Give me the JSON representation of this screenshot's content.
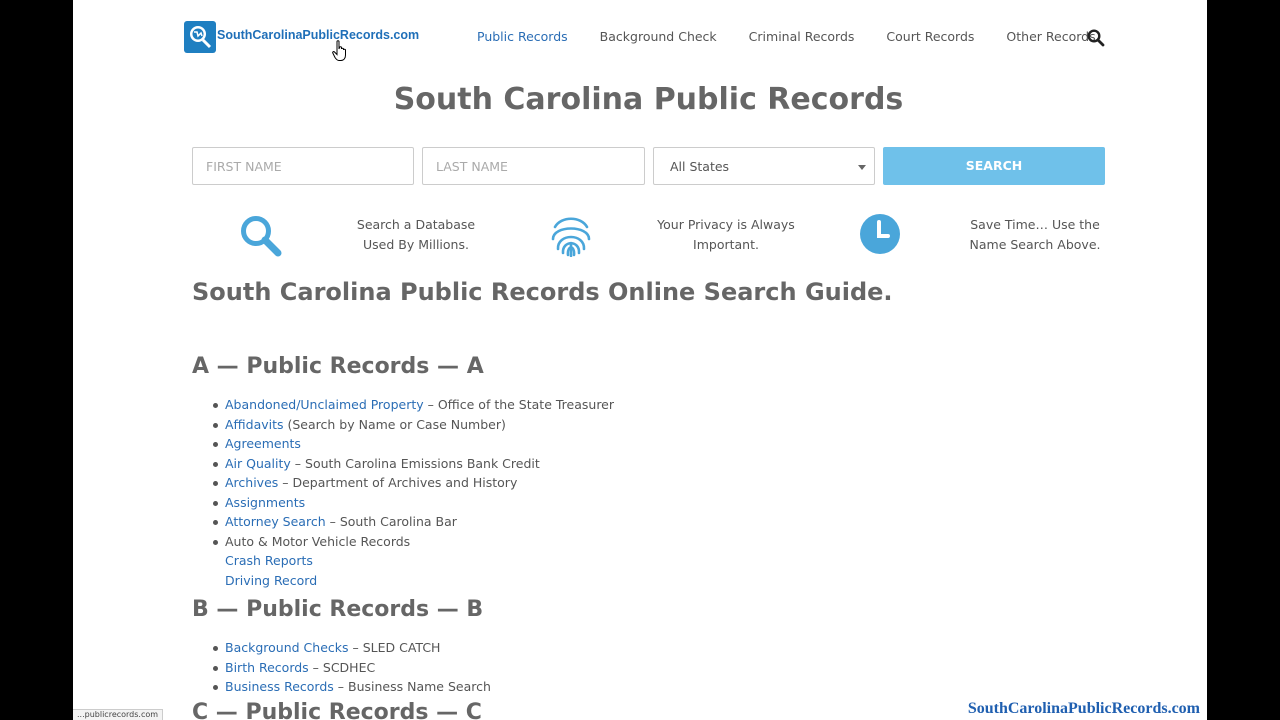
{
  "header": {
    "logo_text": "SouthCarolinaPublicRecords.com",
    "nav": [
      {
        "label": "Public Records",
        "active": true
      },
      {
        "label": "Background Check",
        "active": false
      },
      {
        "label": "Criminal Records",
        "active": false
      },
      {
        "label": "Court Records",
        "active": false
      },
      {
        "label": "Other Records",
        "active": false
      }
    ]
  },
  "page_title": "South Carolina Public Records",
  "search": {
    "first_name_placeholder": "FIRST NAME",
    "last_name_placeholder": "LAST NAME",
    "state_value": "All States",
    "button_label": "SEARCH"
  },
  "features": [
    {
      "icon": "search-icon",
      "text_line1": "Search a Database",
      "text_line2": "Used By Millions."
    },
    {
      "icon": "fingerprint-icon",
      "text_line1": "Your Privacy is Always",
      "text_line2": "Important."
    },
    {
      "icon": "clock-icon",
      "text_line1": "Save Time… Use the",
      "text_line2": "Name Search Above."
    }
  ],
  "guide_title": "South Carolina Public Records Online Search Guide.",
  "sections": {
    "a": {
      "title": "A — Public Records — A",
      "items": [
        {
          "link": "Abandoned/Unclaimed Property",
          "desc": " – Office of the State Treasurer"
        },
        {
          "link": "Affidavits",
          "desc": " (Search by Name or Case Number)"
        },
        {
          "link": "Agreements",
          "desc": ""
        },
        {
          "link": "Air Quality",
          "desc": " – South Carolina Emissions Bank Credit"
        },
        {
          "link": "Archives",
          "desc": " – Department of Archives and History"
        },
        {
          "link": "Assignments",
          "desc": ""
        },
        {
          "link": "Attorney Search",
          "desc": " – South Carolina Bar"
        },
        {
          "text": "Auto & Motor Vehicle Records"
        },
        {
          "sublink": "Crash Reports"
        },
        {
          "sublink": "Driving Record"
        }
      ]
    },
    "b": {
      "title": "B — Public Records — B",
      "items": [
        {
          "link": "Background Checks",
          "desc": " – SLED CATCH"
        },
        {
          "link": "Birth Records",
          "desc": " – SCDHEC"
        },
        {
          "link": "Business Records",
          "desc": " – Business Name Search"
        }
      ]
    },
    "c": {
      "title": "C — Public Records — C"
    }
  },
  "status_url": "...publicrecords.com",
  "watermark": "SouthCarolinaPublicRecords.com",
  "colors": {
    "link": "#2a6db5",
    "accent": "#6fc1ea",
    "text": "#555555"
  }
}
